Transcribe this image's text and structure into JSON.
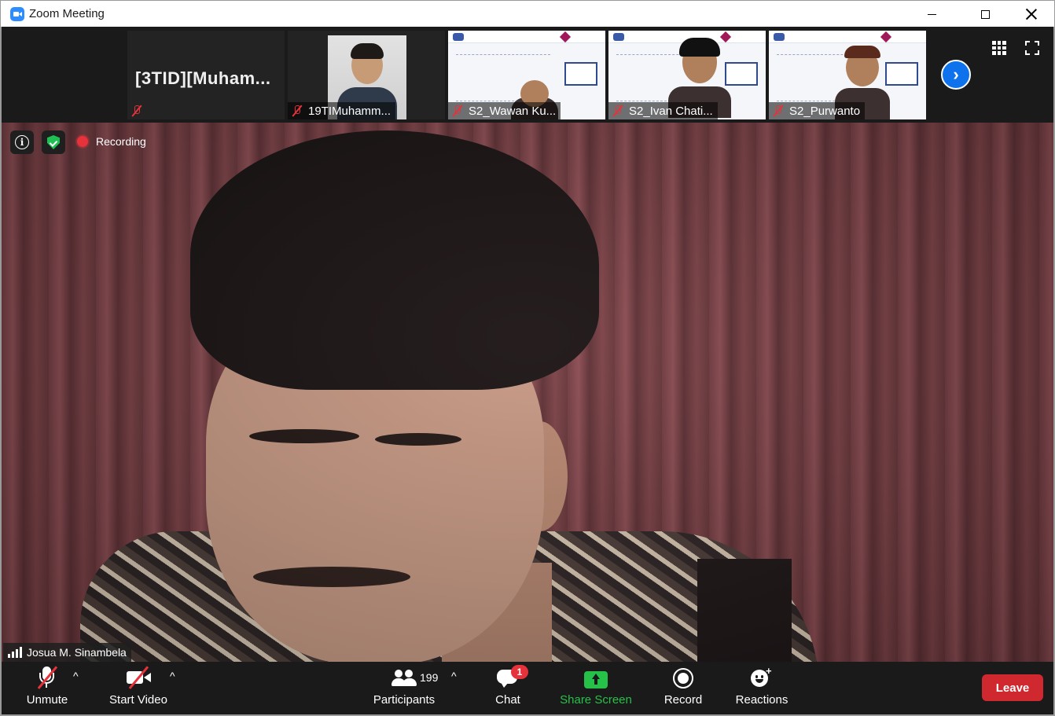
{
  "window": {
    "title": "Zoom Meeting"
  },
  "thumbnails": [
    {
      "name": "[3TID][Muham...",
      "display_text": "[3TID][Muham...",
      "muted": true
    },
    {
      "name": "19TIMuhamm...",
      "muted": true
    },
    {
      "name": "S2_Wawan Ku...",
      "muted": true
    },
    {
      "name": "S2_Ivan Chati...",
      "muted": true
    },
    {
      "name": "S2_Purwanto",
      "muted": true
    }
  ],
  "main_video": {
    "recording_label": "Recording",
    "speaker_name": "Josua M. Sinambela"
  },
  "toolbar": {
    "unmute_label": "Unmute",
    "start_video_label": "Start Video",
    "participants_label": "Participants",
    "participants_count": "199",
    "chat_label": "Chat",
    "chat_badge": "1",
    "share_screen_label": "Share Screen",
    "record_label": "Record",
    "reactions_label": "Reactions",
    "leave_label": "Leave"
  },
  "colors": {
    "accent_blue": "#0e72ed",
    "muted_red": "#e5323b",
    "share_green": "#25c148",
    "leave_red": "#d0282f"
  },
  "icons": [
    "zoom-app-icon",
    "minimize-icon",
    "maximize-icon",
    "close-icon",
    "muted-mic-icon",
    "next-page-icon",
    "gallery-view-icon",
    "fullscreen-icon",
    "info-icon",
    "shield-icon",
    "recording-dot-icon",
    "signal-icon",
    "microphone-icon",
    "video-camera-icon",
    "participants-icon",
    "chat-icon",
    "share-screen-icon",
    "record-icon",
    "reactions-icon"
  ]
}
